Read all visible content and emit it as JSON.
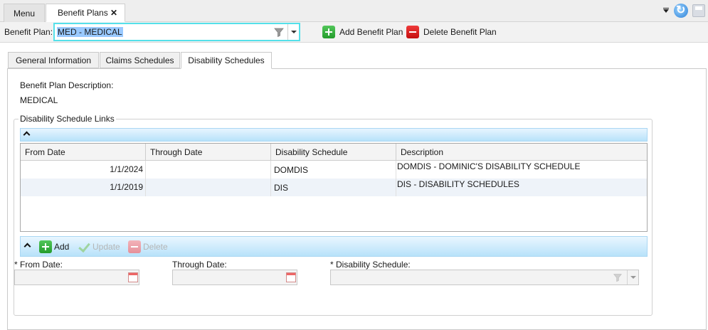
{
  "tabs": {
    "menu": "Menu",
    "active": "Benefit Plans",
    "close": "✕"
  },
  "toolbar": {
    "benefit_plan_label": "Benefit Plan:",
    "benefit_plan_value": "MED - MEDICAL",
    "add_label": "Add Benefit Plan",
    "delete_label": "Delete Benefit Plan"
  },
  "subtabs": [
    "General Information",
    "Claims Schedules",
    "Disability Schedules"
  ],
  "description": {
    "label": "Benefit Plan Description:",
    "value": "MEDICAL"
  },
  "links": {
    "title": "Disability Schedule Links",
    "columns": [
      "From Date",
      "Through Date",
      "Disability Schedule",
      "Description"
    ],
    "rows": [
      {
        "from": "1/1/2024",
        "through": "",
        "schedule": "DOMDIS",
        "description": "DOMDIS - DOMINIC'S DISABILITY SCHEDULE"
      },
      {
        "from": "1/1/2019",
        "through": "",
        "schedule": "DIS",
        "description": "DIS - DISABILITY SCHEDULES"
      }
    ]
  },
  "editor": {
    "add": "Add",
    "update": "Update",
    "delete": "Delete",
    "from_label": "* From Date:",
    "through_label": "Through Date:",
    "schedule_label": "* Disability Schedule:",
    "from_value": "",
    "through_value": "",
    "schedule_value": ""
  },
  "icons": {
    "refresh": "refresh-icon",
    "save": "save-icon",
    "filter": "funnel-icon",
    "add": "plus-icon",
    "delete": "minus-icon",
    "calendar": "calendar-icon"
  }
}
